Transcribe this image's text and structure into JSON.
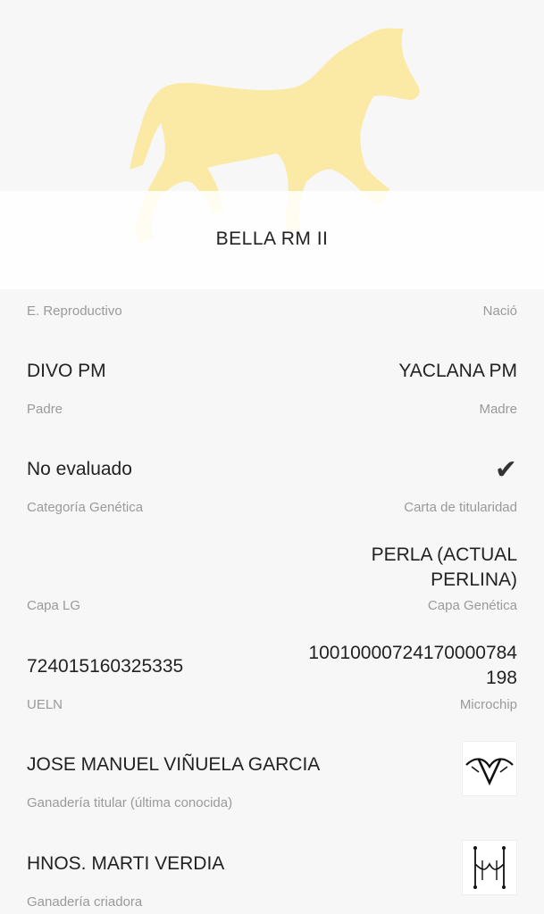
{
  "header": {
    "horse_name": "BELLA RM II"
  },
  "fields": {
    "reproductive_state_label": "E. Reproductivo",
    "born_label": "Nació",
    "father_value": "DIVO PM",
    "father_label": "Padre",
    "mother_value": "YACLANA PM",
    "mother_label": "Madre",
    "genetic_category_value": "No evaluado",
    "genetic_category_label": "Categoría Genética",
    "ownership_card_label": "Carta de titularidad",
    "capa_lg_label": "Capa LG",
    "capa_genetica_value_line1": "PERLA (ACTUAL",
    "capa_genetica_value_line2": "PERLINA)",
    "capa_genetica_label": "Capa Genética",
    "ueln_value": "724015160325335",
    "ueln_label": "UELN",
    "microchip_value_line1": "10010000724170000784",
    "microchip_value_line2": "198",
    "microchip_label": "Microchip",
    "owner_value": "JOSE MANUEL VIÑUELA GARCIA",
    "owner_label": "Ganadería titular (última conocida)",
    "breeder_value": "HNOS. MARTI VERDIA",
    "breeder_label": "Ganadería criadora"
  },
  "icons": {
    "ownership_check": "checkmark-icon",
    "owner_logo": "owner-brand-logo",
    "breeder_logo": "breeder-brand-logo"
  },
  "colors": {
    "horse_silhouette": "#fbe9a6",
    "background": "#f7f7f7",
    "label_gray": "#9a9a9a",
    "text": "#222222"
  }
}
